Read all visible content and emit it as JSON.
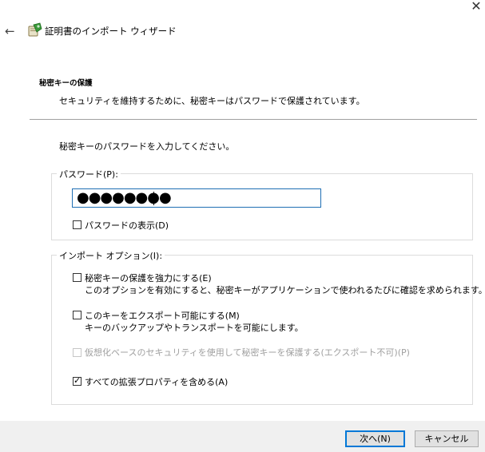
{
  "window": {
    "title": "証明書のインポート ウィザード",
    "close_glyph": "✕",
    "back_glyph": "←"
  },
  "header": {
    "section_title": "秘密キーの保護",
    "section_desc": "セキュリティを維持するために、秘密キーはパスワードで保護されています。"
  },
  "content": {
    "prompt": "秘密キーのパスワードを入力してください。",
    "password_group": {
      "legend": "パスワード(P):",
      "masked_value": "●●●●●●●●",
      "show_password_label": "パスワードの表示(D)",
      "show_password_checked": false
    },
    "import_options": {
      "legend": "インポート オプション(I):",
      "options": [
        {
          "label": "秘密キーの保護を強力にする(E)",
          "desc": "このオプションを有効にすると、秘密キーがアプリケーションで使われるたびに確認を求められます。",
          "checked": false,
          "enabled": true
        },
        {
          "label": "このキーをエクスポート可能にする(M)",
          "desc": "キーのバックアップやトランスポートを可能にします。",
          "checked": false,
          "enabled": true
        },
        {
          "label": "仮想化ベースのセキュリティを使用して秘密キーを保護する(エクスポート不可)(P)",
          "desc": "",
          "checked": false,
          "enabled": false
        },
        {
          "label": "すべての拡張プロパティを含める(A)",
          "desc": "",
          "checked": true,
          "enabled": true
        }
      ]
    }
  },
  "footer": {
    "next_label": "次へ(N)",
    "cancel_label": "キャンセル"
  },
  "colors": {
    "accent": "#0078d7",
    "footer_bg": "#f0f0f0",
    "disabled_text": "#a0a0a0"
  },
  "icons": {
    "wizard": "certificate-wizard-icon",
    "back": "back-arrow-icon",
    "close": "close-icon",
    "check": "checkmark-icon"
  }
}
